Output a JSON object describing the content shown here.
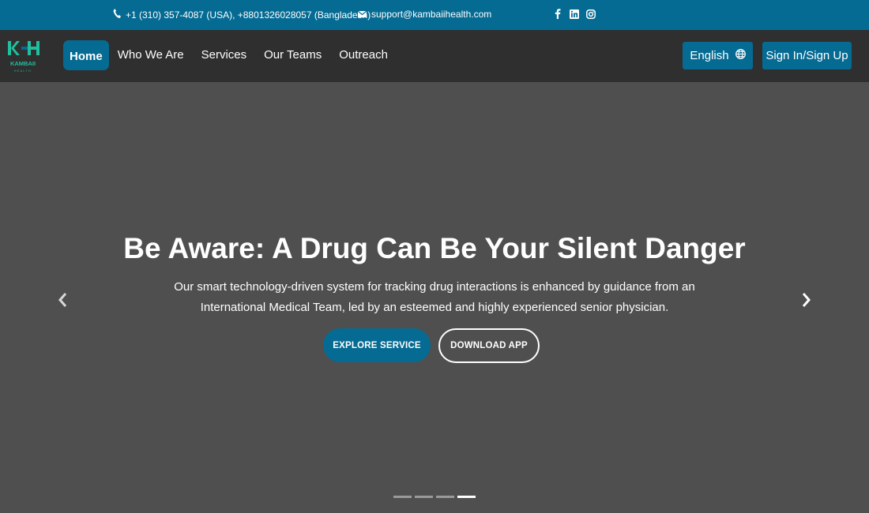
{
  "topbar": {
    "phone": "+1 (310) 357-4087 (USA), +8801326028057 (Bangladesh)",
    "email": "support@kambaiihealth.com",
    "socials": [
      "facebook-icon",
      "linkedin-icon",
      "instagram-icon"
    ]
  },
  "brand": {
    "logo_text": "KAMBAII",
    "logo_subtext": "HEALTH"
  },
  "nav": {
    "items": [
      {
        "label": "Home",
        "active": true
      },
      {
        "label": "Who We Are"
      },
      {
        "label": "Services"
      },
      {
        "label": "Our Teams"
      },
      {
        "label": "Outreach"
      }
    ],
    "language": "English",
    "signin": "Sign In/Sign Up"
  },
  "hero": {
    "title": "Be Aware: A Drug Can Be Your Silent Danger",
    "description": "Our smart technology-driven system for tracking drug interactions is enhanced by guidance from an International Medical Team, led by an esteemed and highly experienced senior physician.",
    "primary_button": "EXPLORE SERVICE",
    "secondary_button": "DOWNLOAD APP",
    "slide_count": 4,
    "active_slide": 4
  },
  "colors": {
    "brand_blue": "#056b93",
    "nav_bg": "#2f2f2f",
    "hero_bg": "#4f4f4f",
    "logo_green": "#1fbf9f"
  }
}
